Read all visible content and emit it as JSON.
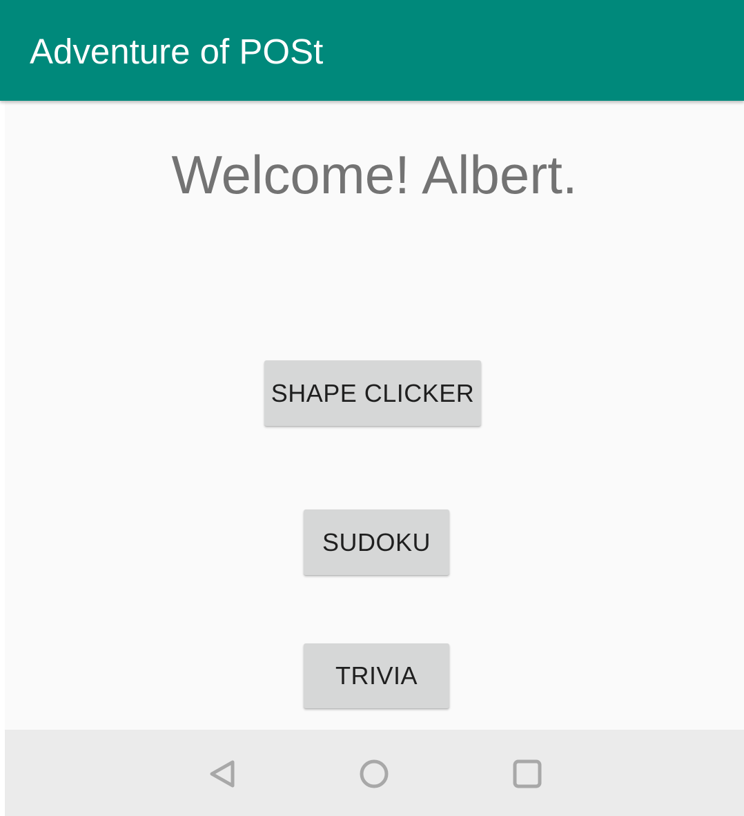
{
  "app_bar": {
    "title": "Adventure of POSt",
    "color": "#00897b"
  },
  "main": {
    "welcome_text": "Welcome! Albert.",
    "buttons": [
      {
        "label": "SHAPE CLICKER"
      },
      {
        "label": "SUDOKU"
      },
      {
        "label": "TRIVIA"
      }
    ]
  },
  "nav_bar": {
    "icons": [
      "back-icon",
      "home-icon",
      "recents-icon"
    ]
  }
}
